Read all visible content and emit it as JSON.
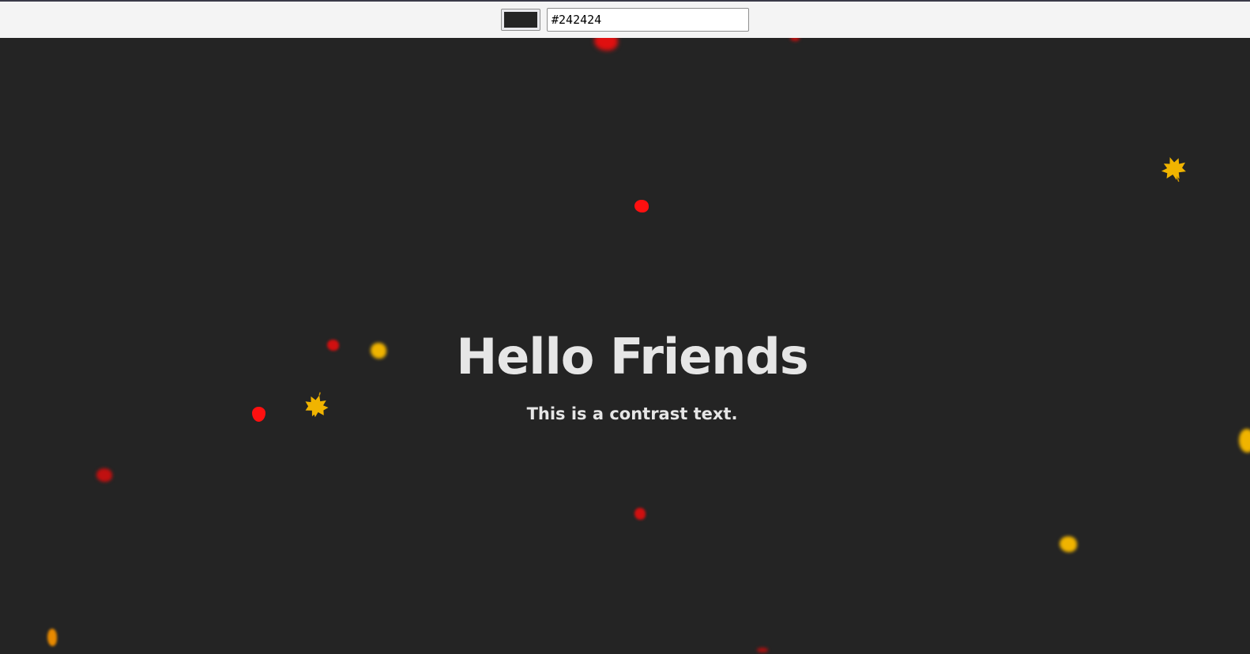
{
  "toolbar": {
    "color_value": "#242424",
    "hex_value": "#242424"
  },
  "content": {
    "title": "Hello Friends",
    "subtitle": "This is a contrast text."
  },
  "colors": {
    "background": "#242424",
    "text": "#e6e6e6",
    "leaf_red": "#e01010",
    "leaf_yellow": "#f0b400",
    "leaf_orange": "#e88a00"
  },
  "icons": {
    "maple_leaf": "maple-leaf-icon",
    "round_leaf": "leaf-icon"
  }
}
